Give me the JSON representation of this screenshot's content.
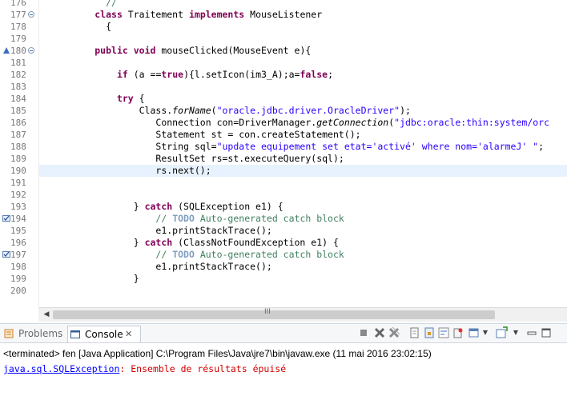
{
  "editor": {
    "line_numbers": [
      "176",
      "177",
      "178",
      "179",
      "180",
      "181",
      "182",
      "183",
      "184",
      "185",
      "186",
      "187",
      "188",
      "189",
      "190",
      "191",
      "192",
      "193",
      "194",
      "195",
      "196",
      "197",
      "198",
      "199",
      "200"
    ]
  },
  "code": {
    "l176": "            //",
    "l177_kw": "class",
    "l177_name": " Traitement ",
    "l177_kw2": "implements",
    "l177_type": " MouseListener",
    "l178": "            {",
    "l180_kw1": "public",
    "l180_kw2": "void",
    "l180_rest": " mouseClicked(MouseEvent e){",
    "l182_if": "if",
    "l182_a": "(a ",
    "l182_eq": "==",
    "l182_true": "true",
    "l182_rest": "){l.setIcon(im3_A);a=",
    "l182_false": "false",
    "l182_end": ";",
    "l184_try": "try",
    "l184_brace": " {",
    "l185_a": "Class.",
    "l185_m": "forName",
    "l185_p": "(",
    "l185_s": "\"oracle.jdbc.driver.OracleDriver\"",
    "l185_e": ");",
    "l186_a": "Connection con=DriverManager.",
    "l186_m": "getConnection",
    "l186_p": "(",
    "l186_s": "\"jdbc:oracle:thin:system/orc",
    "l187": "Statement st = con.createStatement();",
    "l188_a": "String sql=",
    "l188_s": "\"update equipement set etat='activé' where nom='alarmeJ' \"",
    "l188_e": ";",
    "l189": "ResultSet rs=st.executeQuery(sql);",
    "l190": "rs.next();",
    "l193_a": "} ",
    "l193_kw": "catch",
    "l193_b": " (SQLException e1) {",
    "l194_c": "// ",
    "l194_todo": "TODO",
    "l194_r": " Auto-generated catch block",
    "l195": "e1.printStackTrace();",
    "l196_a": "} ",
    "l196_kw": "catch",
    "l196_b": " (ClassNotFoundException e1) {",
    "l197_c": "// ",
    "l197_todo": "TODO",
    "l197_r": " Auto-generated catch block",
    "l198": "e1.printStackTrace();",
    "l199": "}"
  },
  "scrollbar": {
    "left_arrow": "◀",
    "right_arrow": "▶",
    "grip": "III"
  },
  "console_view": {
    "tabs": [
      {
        "label": "Problems"
      },
      {
        "label": "Console",
        "close": "✕"
      }
    ],
    "terminated_line": "<terminated> fen [Java Application] C:\\Program Files\\Java\\jre7\\bin\\javaw.exe (11 mai 2016 23:02:15)",
    "exception": "java.sql.SQLException",
    "message": ": Ensemble de résultats épuisé"
  },
  "colors": {
    "keyword": "#7f0055",
    "string": "#2a00ff",
    "comment": "#3f7f5f",
    "current_line": "#e8f2fe",
    "error": "#d00000"
  }
}
